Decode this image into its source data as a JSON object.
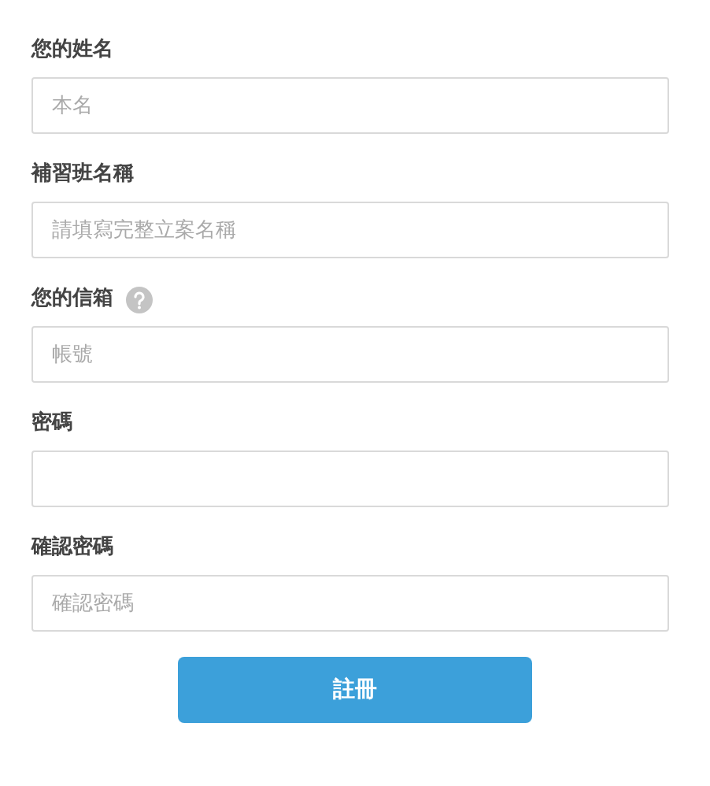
{
  "fields": [
    {
      "label": "您的姓名",
      "placeholder": "本名",
      "help_icon": false
    },
    {
      "label": "補習班名稱",
      "placeholder": "請填寫完整立案名稱",
      "help_icon": false
    },
    {
      "label": "您的信箱",
      "placeholder": "帳號",
      "help_icon": true
    },
    {
      "label": "密碼",
      "help_icon": false
    },
    {
      "label": "確認密碼",
      "placeholder": "確認密碼",
      "help_icon": false
    }
  ],
  "submit_button": "註冊"
}
